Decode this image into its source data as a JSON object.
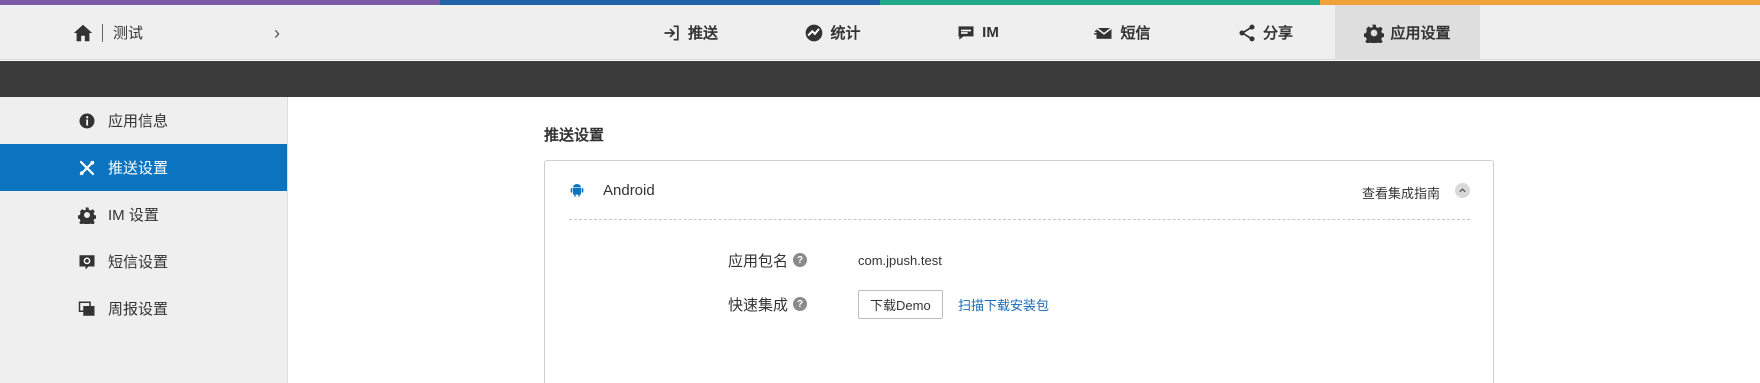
{
  "colors": {
    "strip": [
      "#7b5aa6",
      "#2361a8",
      "#1fa88a",
      "#2fb873",
      "#f0a239"
    ],
    "primary": "#0b74c1",
    "dark_band": "#3b3b3b"
  },
  "header": {
    "app_name": "测试",
    "nav": [
      {
        "label": "推送",
        "icon": "login-icon"
      },
      {
        "label": "统计",
        "icon": "stats-icon"
      },
      {
        "label": "IM",
        "icon": "chat-icon"
      },
      {
        "label": "短信",
        "icon": "sms-icon"
      },
      {
        "label": "分享",
        "icon": "share-icon"
      },
      {
        "label": "应用设置",
        "icon": "gear-icon",
        "active": true
      }
    ]
  },
  "sidebar": {
    "items": [
      {
        "label": "应用信息",
        "icon": "info-icon"
      },
      {
        "label": "推送设置",
        "icon": "tools-icon",
        "active": true
      },
      {
        "label": "IM 设置",
        "icon": "im-gear-icon"
      },
      {
        "label": "短信设置",
        "icon": "sms-gear-icon"
      },
      {
        "label": "周报设置",
        "icon": "report-icon"
      }
    ]
  },
  "main": {
    "section_title": "推送设置",
    "card": {
      "platform": "Android",
      "guide_link": "查看集成指南",
      "package_label": "应用包名",
      "package_value": "com.jpush.test",
      "quick_label": "快速集成",
      "download_button": "下载Demo",
      "scan_link": "扫描下载安装包"
    }
  }
}
